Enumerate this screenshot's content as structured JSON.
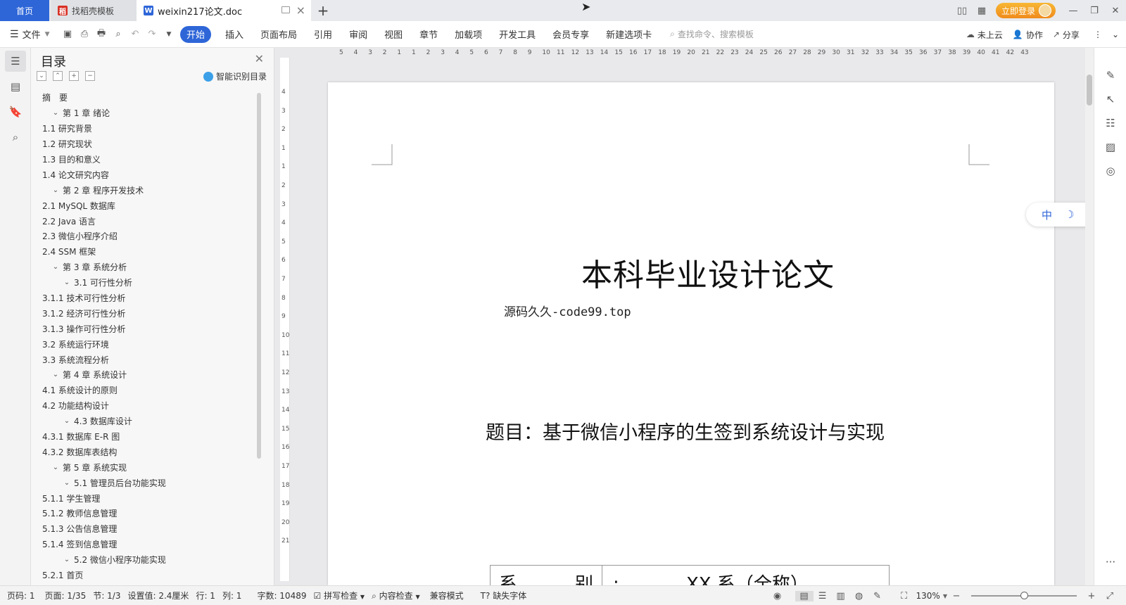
{
  "tabs": {
    "home": "首页",
    "items": [
      {
        "label": "找稻壳模板",
        "color": "#d93025",
        "icon": "docer-icon"
      },
      {
        "label": "weixin217论文.doc",
        "color": "#2e66d8",
        "icon": "wps-writer-icon"
      }
    ],
    "add": "+"
  },
  "titlebar": {
    "login": "立即登录"
  },
  "ribbon": {
    "file": "文件",
    "tabs": [
      "开始",
      "插入",
      "页面布局",
      "引用",
      "审阅",
      "视图",
      "章节",
      "加载项",
      "开发工具",
      "会员专享",
      "新建选项卡"
    ],
    "active_tab": "开始",
    "search_placeholder": "查找命令、搜索模板",
    "cloud": "未上云",
    "collab": "协作",
    "share": "分享"
  },
  "toc": {
    "title": "目录",
    "smart": "智能识别目录",
    "items": [
      {
        "text": "摘　要",
        "level": 0,
        "chevron": ""
      },
      {
        "text": "第 1 章  绪论",
        "level": 0,
        "chevron": "⌄"
      },
      {
        "text": "1.1  研究背景",
        "level": 1,
        "chevron": ""
      },
      {
        "text": "1.2  研究现状",
        "level": 1,
        "chevron": ""
      },
      {
        "text": "1.3  目的和意义",
        "level": 1,
        "chevron": ""
      },
      {
        "text": "1.4  论文研究内容",
        "level": 1,
        "chevron": ""
      },
      {
        "text": "第 2 章  程序开发技术",
        "level": 0,
        "chevron": "⌄"
      },
      {
        "text": "2.1 MySQL 数据库",
        "level": 1,
        "chevron": ""
      },
      {
        "text": "2.2 Java 语言",
        "level": 1,
        "chevron": ""
      },
      {
        "text": "2.3  微信小程序介绍",
        "level": 1,
        "chevron": ""
      },
      {
        "text": "2.4 SSM 框架",
        "level": 1,
        "chevron": ""
      },
      {
        "text": "第 3 章  系统分析",
        "level": 0,
        "chevron": "⌄"
      },
      {
        "text": "3.1 可行性分析",
        "level": 1,
        "chevron": "⌄"
      },
      {
        "text": "3.1.1 技术可行性分析",
        "level": 2,
        "chevron": ""
      },
      {
        "text": "3.1.2 经济可行性分析",
        "level": 2,
        "chevron": ""
      },
      {
        "text": "3.1.3 操作可行性分析",
        "level": 2,
        "chevron": ""
      },
      {
        "text": "3.2 系统运行环境",
        "level": 1,
        "chevron": ""
      },
      {
        "text": "3.3 系统流程分析",
        "level": 1,
        "chevron": ""
      },
      {
        "text": "第 4 章  系统设计",
        "level": 0,
        "chevron": "⌄"
      },
      {
        "text": "4.1  系统设计的原则",
        "level": 1,
        "chevron": ""
      },
      {
        "text": "4.2  功能结构设计",
        "level": 1,
        "chevron": ""
      },
      {
        "text": "4.3  数据库设计",
        "level": 1,
        "chevron": "⌄"
      },
      {
        "text": "4.3.1  数据库 E-R 图",
        "level": 2,
        "chevron": ""
      },
      {
        "text": "4.3.2  数据库表结构",
        "level": 2,
        "chevron": ""
      },
      {
        "text": "第 5 章  系统实现",
        "level": 0,
        "chevron": "⌄"
      },
      {
        "text": "5.1 管理员后台功能实现",
        "level": 1,
        "chevron": "⌄"
      },
      {
        "text": "5.1.1  学生管理",
        "level": 2,
        "chevron": ""
      },
      {
        "text": "5.1.2  教师信息管理",
        "level": 2,
        "chevron": ""
      },
      {
        "text": "5.1.3  公告信息管理",
        "level": 2,
        "chevron": ""
      },
      {
        "text": "5.1.4  签到信息管理",
        "level": 2,
        "chevron": ""
      },
      {
        "text": "5.2  微信小程序功能实现",
        "level": 1,
        "chevron": "⌄"
      },
      {
        "text": "5.2.1  首页",
        "level": 2,
        "chevron": ""
      }
    ]
  },
  "ruler": {
    "h_ticks": [
      "5",
      "4",
      "3",
      "2",
      "1",
      "1",
      "2",
      "3",
      "4",
      "5",
      "6",
      "7",
      "8",
      "9",
      "10",
      "11",
      "12",
      "13",
      "14",
      "15",
      "16",
      "17",
      "18",
      "19",
      "20",
      "21",
      "22",
      "23",
      "24",
      "25",
      "26",
      "27",
      "28",
      "29",
      "30",
      "31",
      "32",
      "33",
      "34",
      "35",
      "36",
      "37",
      "38",
      "39",
      "40",
      "41",
      "42",
      "43"
    ],
    "v_ticks": [
      "4",
      "3",
      "2",
      "1",
      "1",
      "2",
      "3",
      "4",
      "5",
      "6",
      "7",
      "8",
      "9",
      "10",
      "11",
      "12",
      "13",
      "14",
      "15",
      "16",
      "17",
      "18",
      "19",
      "20",
      "21"
    ]
  },
  "document": {
    "title": "本科毕业设计论文",
    "source": "源码久久-code99.top",
    "topic": "题目：基于微信小程序的生签到系统设计与实现",
    "table_label": "系　别:",
    "table_value": "XX 系（全称）"
  },
  "ime": {
    "lang": "中",
    "moon": "☽",
    "punct": "°,",
    "arrow": "›"
  },
  "statusbar": {
    "page_no": "页码: 1",
    "pages": "页面: 1/35",
    "section": "节: 1/3",
    "setting": "设置值: 2.4厘米",
    "row": "行: 1",
    "col": "列: 1",
    "words": "字数: 10489",
    "spell": "拼写检查",
    "content": "内容检查",
    "compat": "兼容模式",
    "missing_font": "缺失字体",
    "zoom": "130%"
  }
}
